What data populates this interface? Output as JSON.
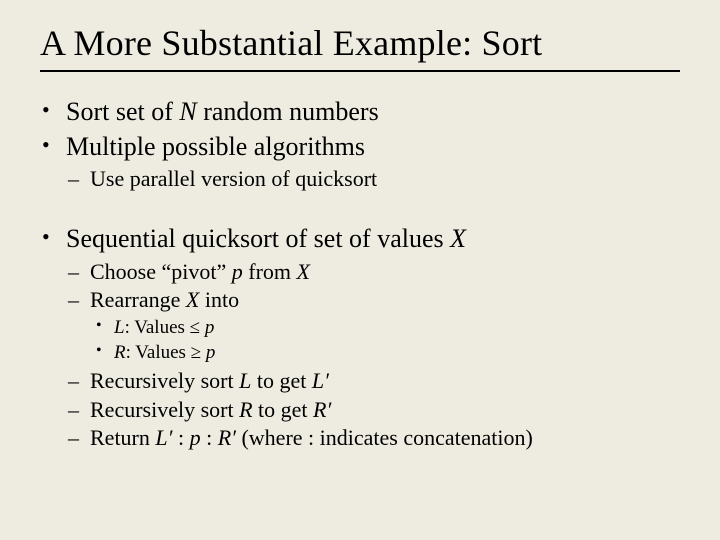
{
  "title": "A More Substantial Example: Sort",
  "b1": {
    "pre": "Sort set of ",
    "N": "N",
    "post": " random numbers"
  },
  "b2": "Multiple possible algorithms",
  "b2a": "Use parallel version of quicksort",
  "b3": {
    "pre": "Sequential quicksort of set of values ",
    "X": "X"
  },
  "b3a": {
    "pre": "Choose “pivot” ",
    "p": "p",
    "mid": " from ",
    "X": "X"
  },
  "b3b": {
    "pre": "Rearrange ",
    "X": "X",
    "post": " into"
  },
  "b3b1": {
    "L": "L",
    "txt": ": Values ≤ ",
    "p": "p"
  },
  "b3b2": {
    "R": "R",
    "txt": ": Values ≥ ",
    "p": "p"
  },
  "b3c": {
    "pre": "Recursively sort ",
    "L": "L",
    "mid": " to get ",
    "Lp": "L′"
  },
  "b3d": {
    "pre": "Recursively sort ",
    "R": "R",
    "mid": " to get ",
    "Rp": "R′"
  },
  "b3e": {
    "pre": "Return ",
    "Lp": "L′",
    "c1": " : ",
    "p": "p",
    "c2": " : ",
    "Rp": "R′",
    "post": " (where : indicates concatenation)"
  }
}
